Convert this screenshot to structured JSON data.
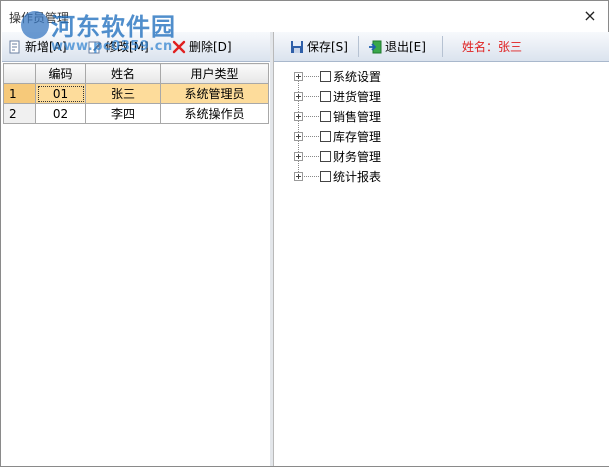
{
  "window": {
    "title": "操作员管理",
    "close_label": "×"
  },
  "watermark": {
    "brand": "河东软件园",
    "url": "www.pc0359.cn"
  },
  "left_toolbar": {
    "add_label": "新增[A]",
    "edit_label": "修改[M]",
    "delete_label": "删除[D]"
  },
  "right_toolbar": {
    "save_label": "保存[S]",
    "exit_label": "退出[E]",
    "name_label": "姓名：张三"
  },
  "table": {
    "headers": [
      "编码",
      "姓名",
      "用户类型"
    ],
    "rows": [
      {
        "num": "1",
        "code": "01",
        "name": "张三",
        "type": "系统管理员"
      },
      {
        "num": "2",
        "code": "02",
        "name": "李四",
        "type": "系统操作员"
      }
    ]
  },
  "tree": {
    "items": [
      "系统设置",
      "进货管理",
      "销售管理",
      "库存管理",
      "财务管理",
      "统计报表"
    ]
  },
  "colors": {
    "accent_red": "#e02020",
    "selection": "#fddc9b"
  },
  "icons": [
    "add-icon",
    "edit-icon",
    "delete-icon",
    "save-icon",
    "exit-icon",
    "close-icon"
  ]
}
